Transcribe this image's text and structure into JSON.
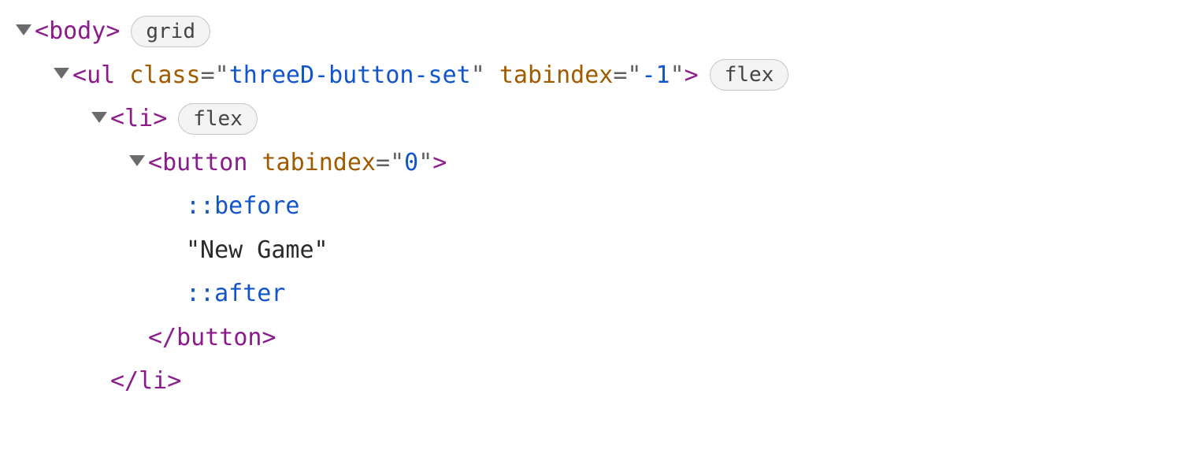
{
  "tree": {
    "row0": {
      "tag": "body",
      "badge": "grid"
    },
    "row1": {
      "tag": "ul",
      "attr1_name": "class",
      "attr1_value": "threeD-button-set",
      "attr2_name": "tabindex",
      "attr2_value": "-1",
      "badge": "flex"
    },
    "row2": {
      "tag": "li",
      "badge": "flex"
    },
    "row3": {
      "tag": "button",
      "attr1_name": "tabindex",
      "attr1_value": "0"
    },
    "row4": {
      "pseudo": "::before"
    },
    "row5": {
      "text": "\"New Game\""
    },
    "row6": {
      "pseudo": "::after"
    },
    "row7": {
      "closeTag": "button"
    },
    "row8": {
      "closeTag": "li"
    }
  },
  "glyphs": {
    "lt": "<",
    "gt": ">",
    "lts": "</",
    "eq": "=",
    "q": "\""
  }
}
